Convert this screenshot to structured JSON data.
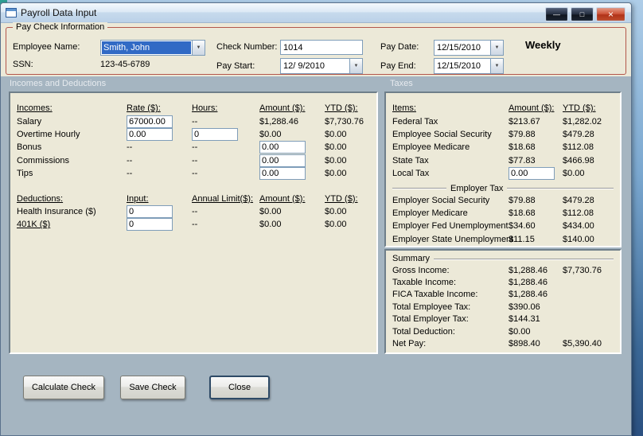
{
  "icons": {
    "minimize": "—",
    "maximize": "□",
    "close": "×",
    "dropdown": "▼"
  },
  "window": {
    "title": "Payroll Data Input"
  },
  "paycheck": {
    "group_label": "Pay Check Information",
    "employee_name_label": "Employee Name:",
    "employee_name_value": "Smith, John",
    "ssn_label": "SSN:",
    "ssn_value": "123-45-6789",
    "check_number_label": "Check Number:",
    "check_number_value": "1014",
    "pay_start_label": "Pay Start:",
    "pay_start_value": "12/ 9/2010",
    "pay_date_label": "Pay Date:",
    "pay_date_value": "12/15/2010",
    "pay_end_label": "Pay End:",
    "pay_end_value": "12/15/2010",
    "frequency": "Weekly"
  },
  "section_headers": {
    "incomes": "Incomes and Deductions",
    "taxes": "Taxes"
  },
  "incomes": {
    "headers": {
      "name": "Incomes:",
      "rate": "Rate ($):",
      "hours": "Hours:",
      "amount": "Amount ($):",
      "ytd": "YTD ($):"
    },
    "rows": [
      {
        "name": "Salary",
        "rate": "67000.00",
        "hours": "--",
        "amount": "$1,288.46",
        "ytd": "$7,730.76"
      },
      {
        "name": "Overtime Hourly",
        "rate": "0.00",
        "hours": "0",
        "amount": "$0.00",
        "ytd": "$0.00"
      },
      {
        "name": "Bonus",
        "rate": "--",
        "hours": "--",
        "amount": "0.00",
        "ytd": "$0.00"
      },
      {
        "name": "Commissions",
        "rate": "--",
        "hours": "--",
        "amount": "0.00",
        "ytd": "$0.00"
      },
      {
        "name": "Tips",
        "rate": "--",
        "hours": "--",
        "amount": "0.00",
        "ytd": "$0.00"
      }
    ]
  },
  "deductions": {
    "headers": {
      "name": "Deductions:",
      "input": "Input:",
      "limit": "Annual Limit($):",
      "amount": "Amount ($):",
      "ytd": "YTD ($):"
    },
    "rows": [
      {
        "name": "Health Insurance  ($)",
        "input": "0",
        "limit": "--",
        "amount": "$0.00",
        "ytd": "$0.00"
      },
      {
        "name": "401K  ($)",
        "input": "0",
        "limit": "--",
        "amount": "$0.00",
        "ytd": "$0.00"
      }
    ]
  },
  "taxes": {
    "headers": {
      "name": "Items:",
      "amount": "Amount ($):",
      "ytd": "YTD ($):"
    },
    "employee_rows": [
      {
        "name": "Federal Tax",
        "amount": "$213.67",
        "ytd": "$1,282.02"
      },
      {
        "name": "Employee Social Security",
        "amount": "$79.88",
        "ytd": "$479.28"
      },
      {
        "name": "Employee Medicare",
        "amount": "$18.68",
        "ytd": "$112.08"
      },
      {
        "name": "State Tax",
        "amount": "$77.83",
        "ytd": "$466.98"
      },
      {
        "name": "Local Tax",
        "amount": "0.00",
        "ytd": "$0.00"
      }
    ],
    "employer_group_label": "Employer Tax",
    "employer_rows": [
      {
        "name": "Employer Social Security",
        "amount": "$79.88",
        "ytd": "$479.28"
      },
      {
        "name": "Employer Medicare",
        "amount": "$18.68",
        "ytd": "$112.08"
      },
      {
        "name": "Employer Fed Unemployment",
        "amount": "$34.60",
        "ytd": "$434.00"
      },
      {
        "name": "Employer State Unemployment",
        "amount": "$11.15",
        "ytd": "$140.00"
      }
    ]
  },
  "summary": {
    "group_label": "Summary",
    "rows": [
      {
        "name": "Gross Income:",
        "amount": "$1,288.46",
        "ytd": "$7,730.76"
      },
      {
        "name": "Taxable Income:",
        "amount": "$1,288.46",
        "ytd": ""
      },
      {
        "name": "FICA Taxable Income:",
        "amount": "$1,288.46",
        "ytd": ""
      },
      {
        "name": "Total Employee Tax:",
        "amount": "$390.06",
        "ytd": ""
      },
      {
        "name": "Total Employer Tax:",
        "amount": "$144.31",
        "ytd": ""
      },
      {
        "name": "Total Deduction:",
        "amount": "$0.00",
        "ytd": ""
      },
      {
        "name": "Net Pay:",
        "amount": "$898.40",
        "ytd": "$5,390.40"
      }
    ]
  },
  "buttons": {
    "calculate": "Calculate Check",
    "save": "Save Check",
    "close": "Close"
  }
}
